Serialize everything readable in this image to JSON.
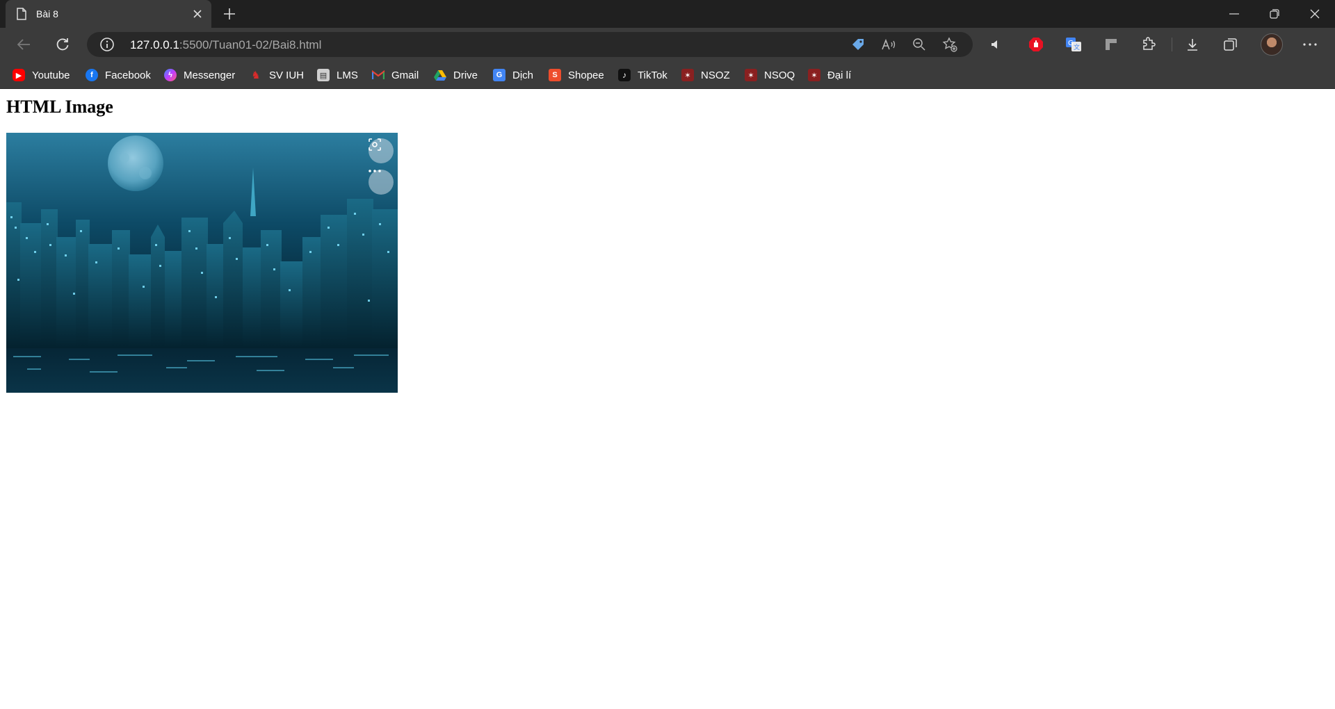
{
  "tab": {
    "title": "Bài 8"
  },
  "address": {
    "host": "127.0.0.1",
    "path": ":5500/Tuan01-02/Bai8.html"
  },
  "bookmarks": [
    {
      "label": "Youtube",
      "icon": "youtube-icon",
      "color": "#ff0000"
    },
    {
      "label": "Facebook",
      "icon": "facebook-icon",
      "color": "#1877f2"
    },
    {
      "label": "Messenger",
      "icon": "messenger-icon",
      "color": "#a04cf5"
    },
    {
      "label": "SV IUH",
      "icon": "iuh-icon",
      "color": "#d92b2b"
    },
    {
      "label": "LMS",
      "icon": "lms-icon",
      "color": "#cfcfcf"
    },
    {
      "label": "Gmail",
      "icon": "gmail-icon",
      "color": "#ea4335"
    },
    {
      "label": "Drive",
      "icon": "drive-icon",
      "color": "#1fa463"
    },
    {
      "label": "Dịch",
      "icon": "translate-icon",
      "color": "#4285f4"
    },
    {
      "label": "Shopee",
      "icon": "shopee-icon",
      "color": "#ee4d2d"
    },
    {
      "label": "TikTok",
      "icon": "tiktok-icon",
      "color": "#111111"
    },
    {
      "label": "NSOZ",
      "icon": "nsoz-icon",
      "color": "#c62828"
    },
    {
      "label": "NSOQ",
      "icon": "nsoq-icon",
      "color": "#c62828"
    },
    {
      "label": "Đại lí",
      "icon": "daili-icon",
      "color": "#c62828"
    }
  ],
  "page": {
    "heading": "HTML Image"
  },
  "colors": {
    "chrome_dark": "#202020",
    "chrome": "#3b3b3b",
    "omnibox": "#282828",
    "accent_red": "#e81123"
  }
}
